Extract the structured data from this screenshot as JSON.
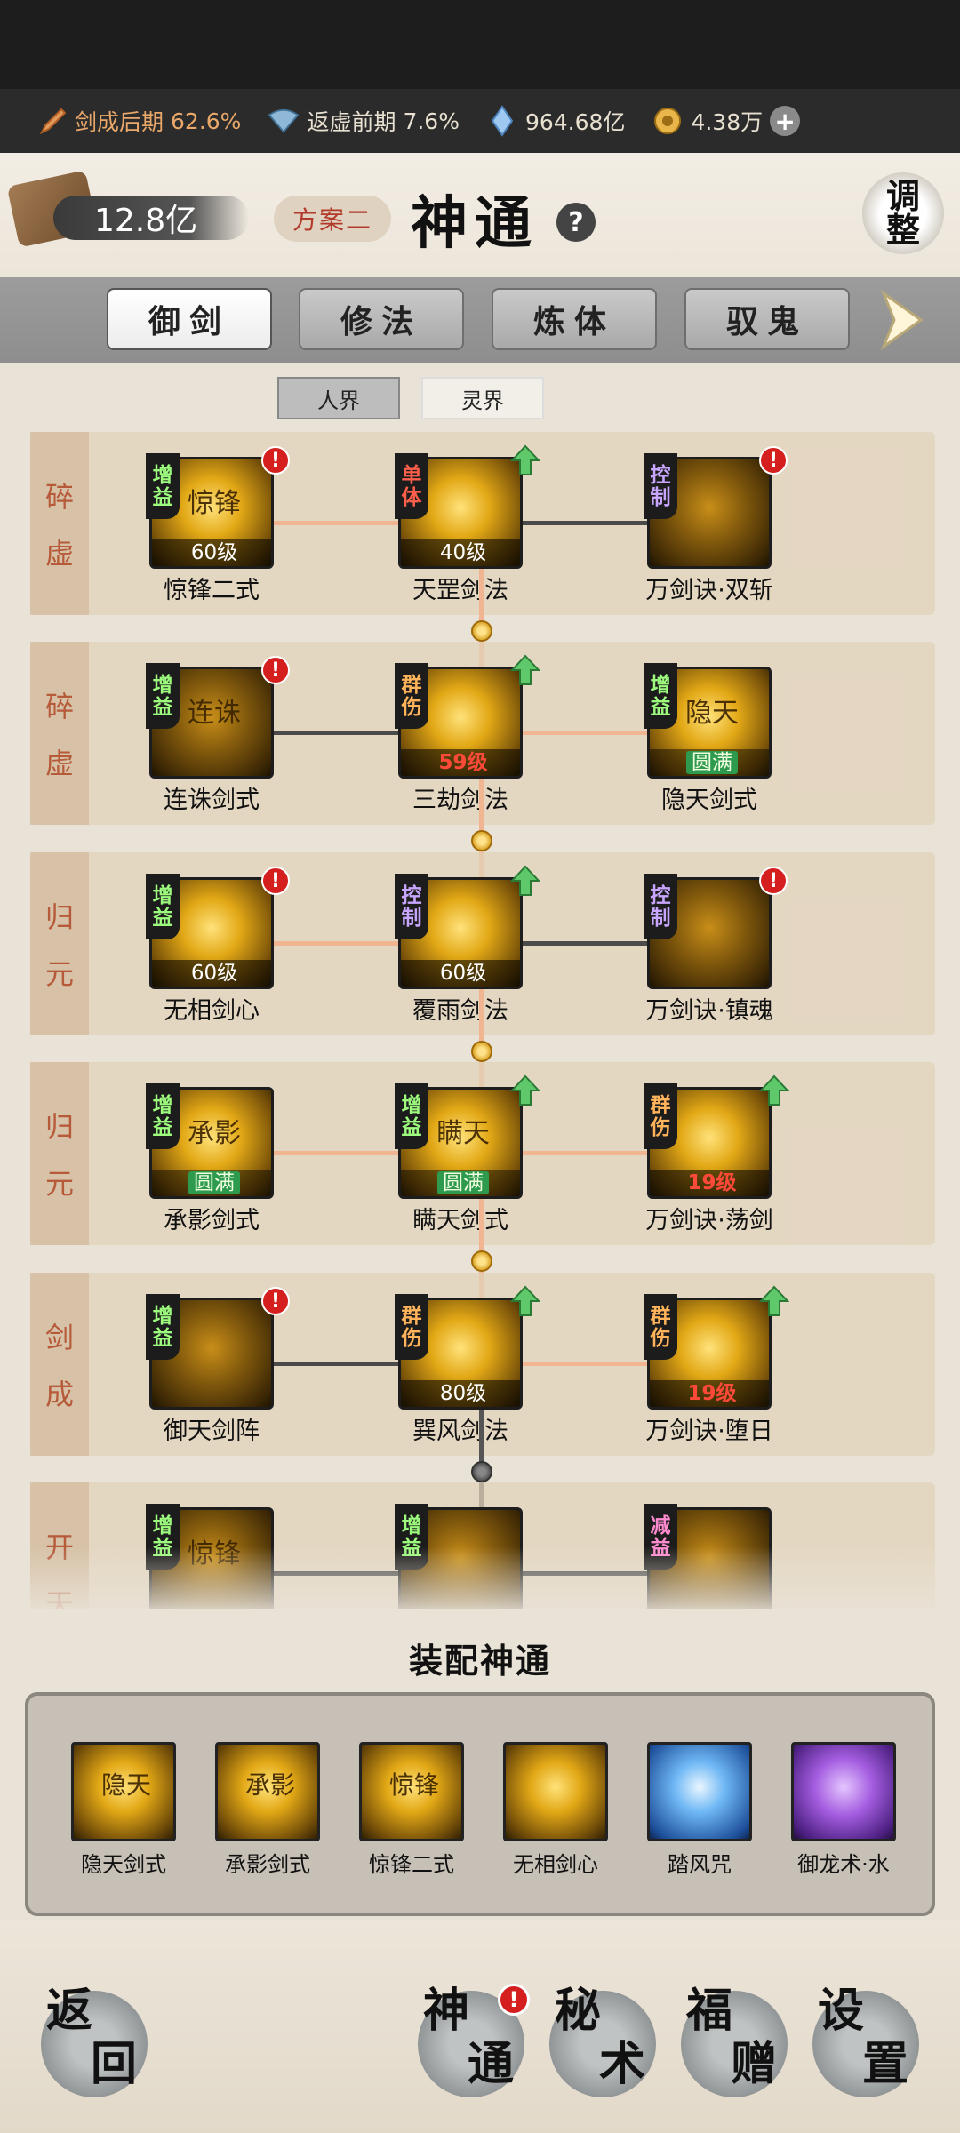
{
  "resources": {
    "realm_progress": {
      "label": "剑成后期",
      "value": "62.6%"
    },
    "sub_progress": {
      "label": "返虚前期",
      "value": "7.6%"
    },
    "crystals": "964.68亿",
    "coins": "4.38万",
    "plus": "+"
  },
  "header": {
    "stones": "12.8亿",
    "plan": "方案二",
    "title": "神通",
    "help": "?",
    "adjust": [
      "调",
      "整"
    ]
  },
  "tabs": [
    "御剑",
    "修法",
    "炼体",
    "驭鬼"
  ],
  "realm_tabs": [
    "人界",
    "灵界"
  ],
  "tree_rows": [
    {
      "stage": [
        "碎",
        "虚"
      ],
      "skills": [
        {
          "name": "惊锋二式",
          "level": "60级",
          "tag": [
            "增",
            "益"
          ],
          "tag_class": "zs",
          "glyph": "惊锋",
          "alert": "!"
        },
        {
          "name": "天罡剑法",
          "level": "40级",
          "tag": [
            "单",
            "体"
          ],
          "tag_class": "qd",
          "glyph": "",
          "upgrade": true
        },
        {
          "name": "万剑诀·双斩",
          "level": "",
          "tag": [
            "控",
            "制"
          ],
          "tag_class": "kz",
          "glyph": "",
          "alert": "!"
        }
      ]
    },
    {
      "stage": [
        "碎",
        "虚"
      ],
      "skills": [
        {
          "name": "连诛剑式",
          "level": "",
          "tag": [
            "增",
            "益"
          ],
          "tag_class": "zs",
          "glyph": "连诛",
          "alert": "!"
        },
        {
          "name": "三劫剑法",
          "level": "59级",
          "tag": [
            "群",
            "伤"
          ],
          "tag_class": "qs",
          "glyph": "",
          "upgrade": true
        },
        {
          "name": "隐天剑式",
          "level": "圆满",
          "tag": [
            "增",
            "益"
          ],
          "tag_class": "zs",
          "glyph": "隐天"
        }
      ]
    },
    {
      "stage": [
        "归",
        "元"
      ],
      "skills": [
        {
          "name": "无相剑心",
          "level": "60级",
          "tag": [
            "增",
            "益"
          ],
          "tag_class": "zs",
          "glyph": "",
          "alert": "!"
        },
        {
          "name": "覆雨剑法",
          "level": "60级",
          "tag": [
            "控",
            "制"
          ],
          "tag_class": "kz",
          "glyph": "",
          "upgrade": true
        },
        {
          "name": "万剑诀·镇魂",
          "level": "",
          "tag": [
            "控",
            "制"
          ],
          "tag_class": "kz",
          "glyph": "",
          "alert": "!"
        }
      ]
    },
    {
      "stage": [
        "归",
        "元"
      ],
      "skills": [
        {
          "name": "承影剑式",
          "level": "圆满",
          "tag": [
            "增",
            "益"
          ],
          "tag_class": "zs",
          "glyph": "承影"
        },
        {
          "name": "瞒天剑式",
          "level": "圆满",
          "tag": [
            "增",
            "益"
          ],
          "tag_class": "zs",
          "glyph": "瞒天",
          "upgrade": true
        },
        {
          "name": "万剑诀·荡剑",
          "level": "19级",
          "tag": [
            "群",
            "伤"
          ],
          "tag_class": "qs",
          "glyph": "",
          "upgrade": true
        }
      ]
    },
    {
      "stage": [
        "剑",
        "成"
      ],
      "skills": [
        {
          "name": "御天剑阵",
          "level": "",
          "tag": [
            "增",
            "益"
          ],
          "tag_class": "zs",
          "glyph": "",
          "alert": "!"
        },
        {
          "name": "巽风剑法",
          "level": "80级",
          "tag": [
            "群",
            "伤"
          ],
          "tag_class": "qs",
          "glyph": "",
          "upgrade": true
        },
        {
          "name": "万剑诀·堕日",
          "level": "19级",
          "tag": [
            "群",
            "伤"
          ],
          "tag_class": "qs",
          "glyph": "",
          "upgrade": true
        }
      ]
    },
    {
      "stage": [
        "开",
        "天"
      ],
      "skills": [
        {
          "name": "",
          "level": "",
          "tag": [
            "增",
            "益"
          ],
          "tag_class": "zs",
          "glyph": "惊锋"
        },
        {
          "name": "",
          "level": "",
          "tag": [
            "增",
            "益"
          ],
          "tag_class": "zs",
          "glyph": ""
        },
        {
          "name": "",
          "level": "",
          "tag": [
            "减",
            "益"
          ],
          "tag_class": "jy",
          "glyph": ""
        }
      ]
    }
  ],
  "equip": {
    "title": "装配神通",
    "slots": [
      {
        "name": "隐天剑式",
        "glyph": "隐天",
        "style": "gold"
      },
      {
        "name": "承影剑式",
        "glyph": "承影",
        "style": "gold"
      },
      {
        "name": "惊锋二式",
        "glyph": "惊锋",
        "style": "gold"
      },
      {
        "name": "无相剑心",
        "glyph": "",
        "style": "gold"
      },
      {
        "name": "踏风咒",
        "glyph": "",
        "style": "blue"
      },
      {
        "name": "御龙术·水",
        "glyph": "",
        "style": "purple"
      }
    ]
  },
  "nav": {
    "back": [
      "返",
      "回"
    ],
    "shentong": [
      "神",
      "通"
    ],
    "mishu": [
      "秘",
      "术"
    ],
    "fuzeng": [
      "福",
      "赠"
    ],
    "settings": [
      "设",
      "置"
    ],
    "alert": "!"
  },
  "colors": {
    "accent": "#e2a816",
    "alert": "#d51f1f",
    "lit_connector": "#f1b591"
  }
}
